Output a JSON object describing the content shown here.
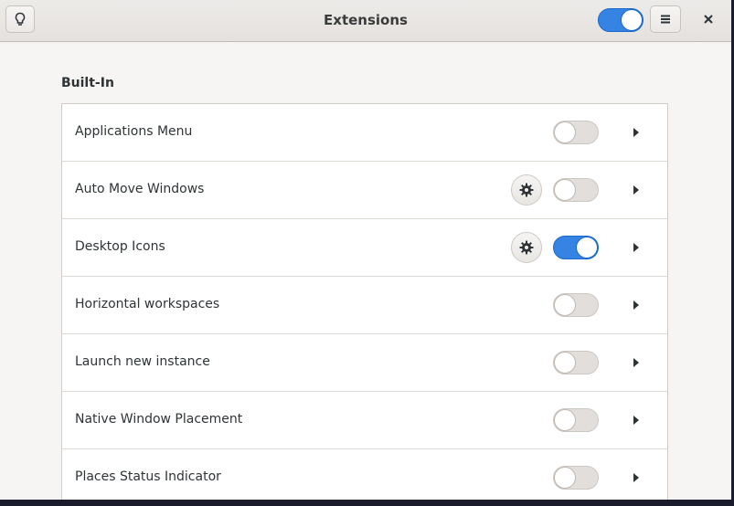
{
  "window": {
    "title": "Extensions"
  },
  "header": {
    "tips_icon": "lightbulb-icon",
    "global_switch_on": true,
    "menu_icon": "hamburger-menu-icon",
    "close_icon": "close-icon"
  },
  "section": {
    "title": "Built-In"
  },
  "extensions": [
    {
      "name": "Applications Menu",
      "has_settings": false,
      "enabled": false
    },
    {
      "name": "Auto Move Windows",
      "has_settings": true,
      "enabled": false
    },
    {
      "name": "Desktop Icons",
      "has_settings": true,
      "enabled": true
    },
    {
      "name": "Horizontal workspaces",
      "has_settings": false,
      "enabled": false
    },
    {
      "name": "Launch new instance",
      "has_settings": false,
      "enabled": false
    },
    {
      "name": "Native Window Placement",
      "has_settings": false,
      "enabled": false
    },
    {
      "name": "Places Status Indicator",
      "has_settings": false,
      "enabled": false
    }
  ],
  "colors": {
    "accent": "#3584e4",
    "background": "#f6f5f4"
  }
}
